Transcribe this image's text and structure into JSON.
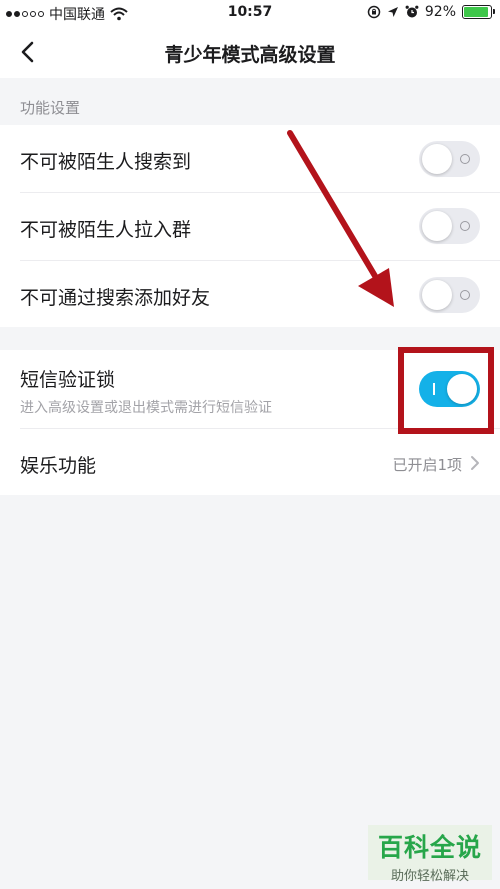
{
  "status_bar": {
    "carrier": "中国联通",
    "time": "10:57",
    "battery_percent_label": "92%",
    "battery_level": 0.92,
    "icons": [
      "signal-dots",
      "wifi-icon",
      "lock-rotation-icon",
      "location-arrow-icon",
      "alarm-icon",
      "battery-icon"
    ]
  },
  "nav": {
    "back_icon": "chevron-left-icon",
    "title": "青少年模式高级设置"
  },
  "section_function": {
    "header": "功能设置",
    "items": [
      {
        "label": "不可被陌生人搜索到",
        "enabled": false
      },
      {
        "label": "不可被陌生人拉入群",
        "enabled": false
      },
      {
        "label": "不可通过搜索添加好友",
        "enabled": false
      }
    ]
  },
  "section_security": {
    "sms_lock": {
      "label": "短信验证锁",
      "description": "进入高级设置或退出模式需进行短信验证",
      "enabled": true
    },
    "entertainment": {
      "label": "娱乐功能",
      "value": "已开启1项"
    }
  },
  "colors": {
    "accent": "#14b1e8",
    "annotation_red": "#b3131b",
    "background": "#f4f5f7"
  },
  "watermark": {
    "title": "百科全说",
    "subtitle": "助你轻松解决"
  }
}
